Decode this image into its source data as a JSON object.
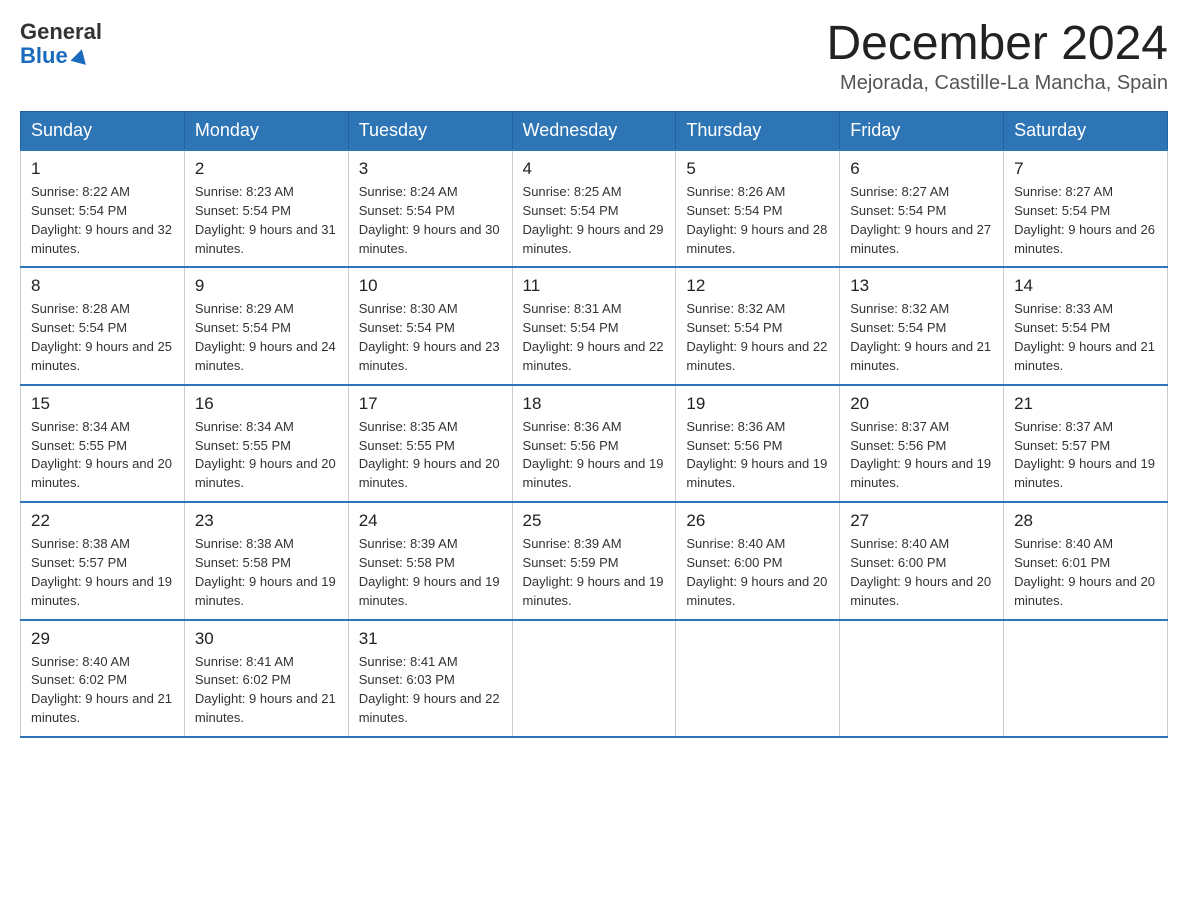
{
  "header": {
    "logo_general": "General",
    "logo_blue": "Blue",
    "month_title": "December 2024",
    "location": "Mejorada, Castille-La Mancha, Spain"
  },
  "weekdays": [
    "Sunday",
    "Monday",
    "Tuesday",
    "Wednesday",
    "Thursday",
    "Friday",
    "Saturday"
  ],
  "weeks": [
    [
      {
        "num": "1",
        "sunrise": "8:22 AM",
        "sunset": "5:54 PM",
        "daylight": "9 hours and 32 minutes"
      },
      {
        "num": "2",
        "sunrise": "8:23 AM",
        "sunset": "5:54 PM",
        "daylight": "9 hours and 31 minutes"
      },
      {
        "num": "3",
        "sunrise": "8:24 AM",
        "sunset": "5:54 PM",
        "daylight": "9 hours and 30 minutes"
      },
      {
        "num": "4",
        "sunrise": "8:25 AM",
        "sunset": "5:54 PM",
        "daylight": "9 hours and 29 minutes"
      },
      {
        "num": "5",
        "sunrise": "8:26 AM",
        "sunset": "5:54 PM",
        "daylight": "9 hours and 28 minutes"
      },
      {
        "num": "6",
        "sunrise": "8:27 AM",
        "sunset": "5:54 PM",
        "daylight": "9 hours and 27 minutes"
      },
      {
        "num": "7",
        "sunrise": "8:27 AM",
        "sunset": "5:54 PM",
        "daylight": "9 hours and 26 minutes"
      }
    ],
    [
      {
        "num": "8",
        "sunrise": "8:28 AM",
        "sunset": "5:54 PM",
        "daylight": "9 hours and 25 minutes"
      },
      {
        "num": "9",
        "sunrise": "8:29 AM",
        "sunset": "5:54 PM",
        "daylight": "9 hours and 24 minutes"
      },
      {
        "num": "10",
        "sunrise": "8:30 AM",
        "sunset": "5:54 PM",
        "daylight": "9 hours and 23 minutes"
      },
      {
        "num": "11",
        "sunrise": "8:31 AM",
        "sunset": "5:54 PM",
        "daylight": "9 hours and 22 minutes"
      },
      {
        "num": "12",
        "sunrise": "8:32 AM",
        "sunset": "5:54 PM",
        "daylight": "9 hours and 22 minutes"
      },
      {
        "num": "13",
        "sunrise": "8:32 AM",
        "sunset": "5:54 PM",
        "daylight": "9 hours and 21 minutes"
      },
      {
        "num": "14",
        "sunrise": "8:33 AM",
        "sunset": "5:54 PM",
        "daylight": "9 hours and 21 minutes"
      }
    ],
    [
      {
        "num": "15",
        "sunrise": "8:34 AM",
        "sunset": "5:55 PM",
        "daylight": "9 hours and 20 minutes"
      },
      {
        "num": "16",
        "sunrise": "8:34 AM",
        "sunset": "5:55 PM",
        "daylight": "9 hours and 20 minutes"
      },
      {
        "num": "17",
        "sunrise": "8:35 AM",
        "sunset": "5:55 PM",
        "daylight": "9 hours and 20 minutes"
      },
      {
        "num": "18",
        "sunrise": "8:36 AM",
        "sunset": "5:56 PM",
        "daylight": "9 hours and 19 minutes"
      },
      {
        "num": "19",
        "sunrise": "8:36 AM",
        "sunset": "5:56 PM",
        "daylight": "9 hours and 19 minutes"
      },
      {
        "num": "20",
        "sunrise": "8:37 AM",
        "sunset": "5:56 PM",
        "daylight": "9 hours and 19 minutes"
      },
      {
        "num": "21",
        "sunrise": "8:37 AM",
        "sunset": "5:57 PM",
        "daylight": "9 hours and 19 minutes"
      }
    ],
    [
      {
        "num": "22",
        "sunrise": "8:38 AM",
        "sunset": "5:57 PM",
        "daylight": "9 hours and 19 minutes"
      },
      {
        "num": "23",
        "sunrise": "8:38 AM",
        "sunset": "5:58 PM",
        "daylight": "9 hours and 19 minutes"
      },
      {
        "num": "24",
        "sunrise": "8:39 AM",
        "sunset": "5:58 PM",
        "daylight": "9 hours and 19 minutes"
      },
      {
        "num": "25",
        "sunrise": "8:39 AM",
        "sunset": "5:59 PM",
        "daylight": "9 hours and 19 minutes"
      },
      {
        "num": "26",
        "sunrise": "8:40 AM",
        "sunset": "6:00 PM",
        "daylight": "9 hours and 20 minutes"
      },
      {
        "num": "27",
        "sunrise": "8:40 AM",
        "sunset": "6:00 PM",
        "daylight": "9 hours and 20 minutes"
      },
      {
        "num": "28",
        "sunrise": "8:40 AM",
        "sunset": "6:01 PM",
        "daylight": "9 hours and 20 minutes"
      }
    ],
    [
      {
        "num": "29",
        "sunrise": "8:40 AM",
        "sunset": "6:02 PM",
        "daylight": "9 hours and 21 minutes"
      },
      {
        "num": "30",
        "sunrise": "8:41 AM",
        "sunset": "6:02 PM",
        "daylight": "9 hours and 21 minutes"
      },
      {
        "num": "31",
        "sunrise": "8:41 AM",
        "sunset": "6:03 PM",
        "daylight": "9 hours and 22 minutes"
      },
      null,
      null,
      null,
      null
    ]
  ],
  "labels": {
    "sunrise": "Sunrise:",
    "sunset": "Sunset:",
    "daylight": "Daylight:"
  }
}
